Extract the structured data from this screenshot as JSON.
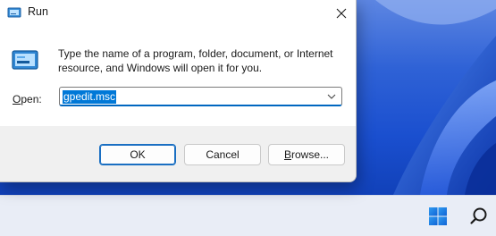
{
  "window": {
    "title": "Run"
  },
  "dialog": {
    "description": "Type the name of a program, folder, document, or Internet resource, and Windows will open it for you.",
    "open_label_accesskey": "O",
    "open_label_rest": "pen:",
    "open_value": "gpedit.msc"
  },
  "buttons": {
    "ok": "OK",
    "cancel": "Cancel",
    "browse_accesskey": "B",
    "browse_rest": "rowse..."
  },
  "colors": {
    "accent": "#0067c0",
    "selection": "#0078d7",
    "wallpaper": "#1a4fcf",
    "taskbar": "#e9edf6"
  },
  "icons": [
    "run-app-icon",
    "close-icon",
    "run-program-icon",
    "chevron-down-icon",
    "windows-start-icon",
    "search-icon"
  ]
}
